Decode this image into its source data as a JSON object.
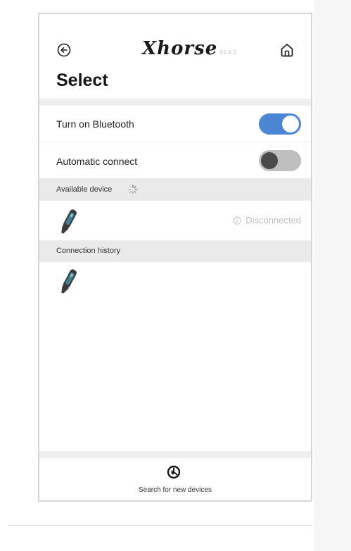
{
  "header": {
    "logo_text": "Xhorse",
    "version": "V1.8.3",
    "title": "Select",
    "back_icon": "circle-arrow-left-icon",
    "home_icon": "home-icon"
  },
  "settings": {
    "bluetooth_label": "Turn on Bluetooth",
    "bluetooth_enabled": true,
    "auto_connect_label": "Automatic connect",
    "auto_connect_enabled": false
  },
  "available": {
    "header": "Available device",
    "status_text": "Disconnected",
    "device_icon": "key-tool-icon"
  },
  "history": {
    "header": "Connection history",
    "device_icon": "key-tool-icon"
  },
  "footer": {
    "search_label": "Search for new devices",
    "search_icon": "search-devices-icon"
  },
  "colors": {
    "accent": "#4a86d1",
    "toggle_off": "#bfbfbf",
    "section_bg": "#eaeaea"
  }
}
